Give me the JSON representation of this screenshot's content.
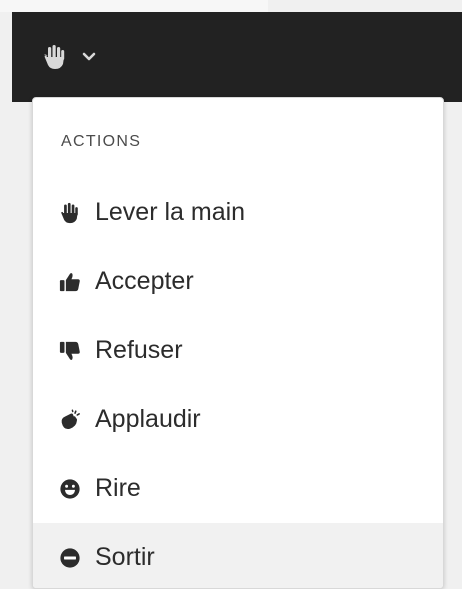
{
  "colors": {
    "toolbar_bg": "#222222",
    "menu_bg": "#ffffff",
    "icon_color": "#2c2c2c",
    "hover_bg": "#f1f1f1"
  },
  "status_button": {
    "icon": "raise-hand-icon",
    "caret_icon": "chevron-down-icon"
  },
  "menu": {
    "heading": "ACTIONS",
    "items": [
      {
        "label": "Lever la main",
        "icon": "raise-hand-icon"
      },
      {
        "label": "Accepter",
        "icon": "thumbs-up-icon"
      },
      {
        "label": "Refuser",
        "icon": "thumbs-down-icon"
      },
      {
        "label": "Applaudir",
        "icon": "applause-icon"
      },
      {
        "label": "Rire",
        "icon": "laugh-icon"
      },
      {
        "label": "Sortir",
        "icon": "step-away-icon"
      }
    ]
  }
}
